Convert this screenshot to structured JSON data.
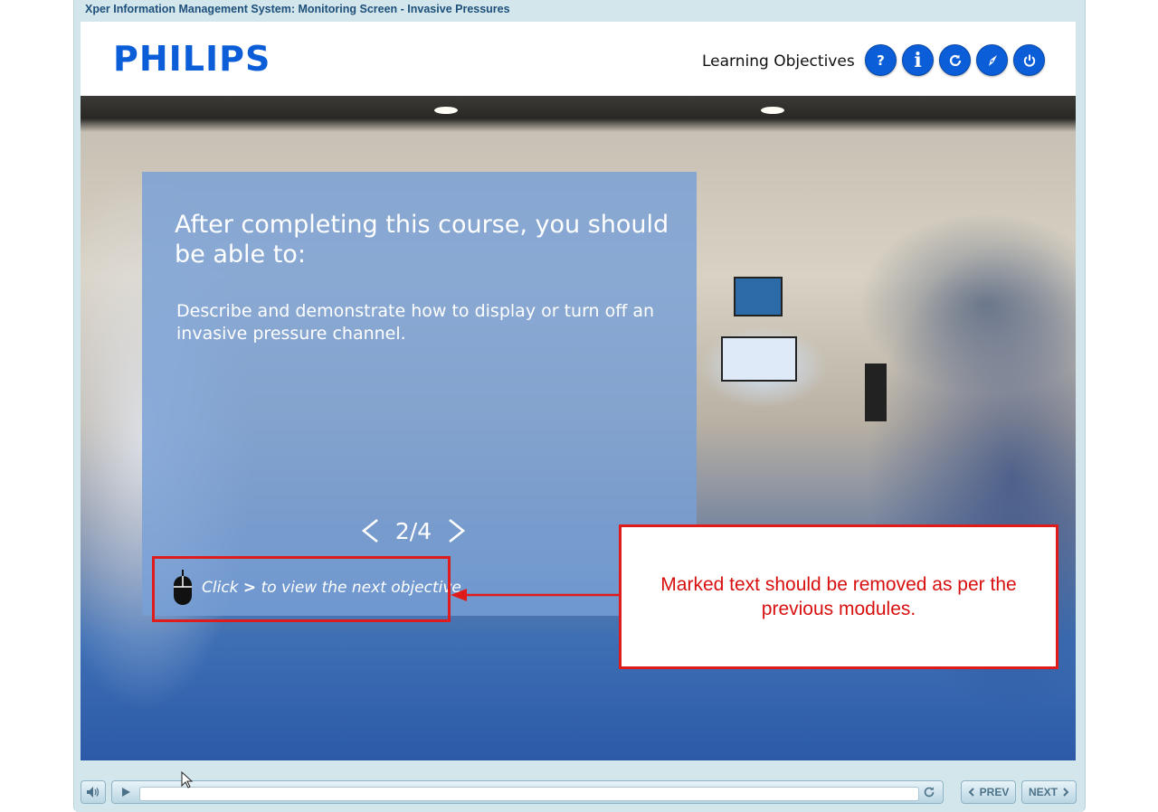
{
  "window": {
    "title": "Xper Information Management System: Monitoring Screen - Invasive Pressures"
  },
  "header": {
    "logo_text": "PHILIPS",
    "section_label": "Learning Objectives",
    "buttons": [
      {
        "name": "help",
        "glyph": "?"
      },
      {
        "name": "info",
        "glyph": "i"
      },
      {
        "name": "replay",
        "icon": "refresh-icon"
      },
      {
        "name": "navigate",
        "icon": "compass-icon"
      },
      {
        "name": "exit",
        "icon": "power-icon"
      }
    ],
    "brand_color": "#0b5ed7"
  },
  "slide": {
    "heading": "After completing this course, you should be able to:",
    "objective": "Describe and demonstrate how to display or turn off an invasive pressure channel.",
    "pager": {
      "current": 2,
      "total": 4,
      "text": "2/4"
    },
    "hint": {
      "prefix": "Click",
      "key": ">",
      "suffix": "to view the next objective."
    }
  },
  "annotation": {
    "note": "Marked text should be removed as per the previous modules.",
    "color": "#e01b1b"
  },
  "playback": {
    "progress": 0,
    "prev_label": "PREV",
    "next_label": "NEXT"
  }
}
